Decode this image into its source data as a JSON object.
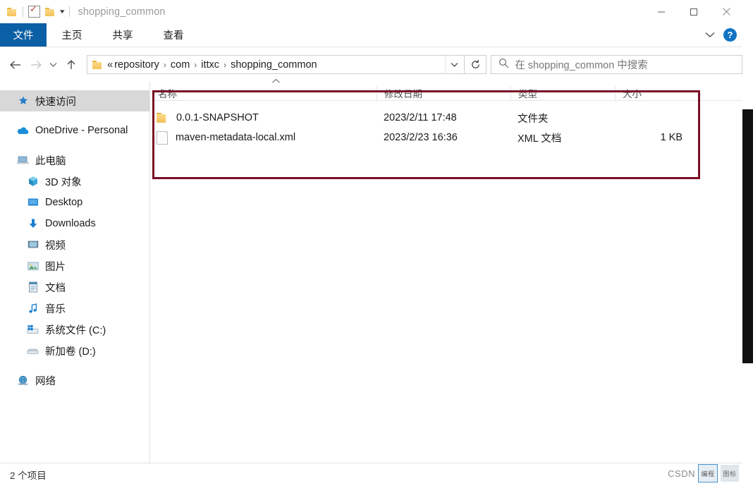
{
  "window": {
    "title": "shopping_common",
    "quick_access": {
      "folder_icon": "folder-icon",
      "properties_icon": "properties-checkmark-icon",
      "new_folder_icon": "new-folder-icon",
      "customize_caret": "chevron-down-icon"
    },
    "controls": {
      "minimize": "minimize-icon",
      "maximize": "maximize-icon",
      "close": "close-icon"
    }
  },
  "ribbon": {
    "tabs": [
      {
        "label": "文件",
        "active": true
      },
      {
        "label": "主页",
        "active": false
      },
      {
        "label": "共享",
        "active": false
      },
      {
        "label": "查看",
        "active": false
      }
    ],
    "collapse_icon": "chevron-down-icon",
    "help_label": "?"
  },
  "navbar": {
    "back_icon": "arrow-left-icon",
    "forward_icon": "arrow-right-icon",
    "history_icon": "chevron-down-icon",
    "up_icon": "arrow-up-icon",
    "address": {
      "folder_icon": "folder-icon",
      "prefix": "«",
      "crumbs": [
        "repository",
        "com",
        "ittxc",
        "shopping_common"
      ],
      "separator": "›",
      "dropdown_icon": "chevron-down-icon"
    },
    "refresh_icon": "refresh-icon",
    "search": {
      "icon": "search-icon",
      "placeholder": "在 shopping_common 中搜索",
      "value": ""
    }
  },
  "sidebar": {
    "items": [
      {
        "label": "快速访问",
        "icon": "pin-star-icon",
        "indent": false,
        "selected": true,
        "gap_before": false
      },
      {
        "label": "OneDrive - Personal",
        "icon": "onedrive-cloud-icon",
        "indent": false,
        "selected": false,
        "gap_before": true
      },
      {
        "label": "此电脑",
        "icon": "this-pc-icon",
        "indent": false,
        "selected": false,
        "gap_before": true
      },
      {
        "label": "3D 对象",
        "icon": "3d-objects-icon",
        "indent": true,
        "selected": false,
        "gap_before": false
      },
      {
        "label": "Desktop",
        "icon": "desktop-icon",
        "indent": true,
        "selected": false,
        "gap_before": false
      },
      {
        "label": "Downloads",
        "icon": "downloads-icon",
        "indent": true,
        "selected": false,
        "gap_before": false
      },
      {
        "label": "视频",
        "icon": "videos-icon",
        "indent": true,
        "selected": false,
        "gap_before": false
      },
      {
        "label": "图片",
        "icon": "pictures-icon",
        "indent": true,
        "selected": false,
        "gap_before": false
      },
      {
        "label": "文档",
        "icon": "documents-icon",
        "indent": true,
        "selected": false,
        "gap_before": false
      },
      {
        "label": "音乐",
        "icon": "music-icon",
        "indent": true,
        "selected": false,
        "gap_before": false
      },
      {
        "label": "系统文件 (C:)",
        "icon": "windows-drive-icon",
        "indent": true,
        "selected": false,
        "gap_before": false
      },
      {
        "label": "新加卷 (D:)",
        "icon": "drive-icon",
        "indent": true,
        "selected": false,
        "gap_before": false
      },
      {
        "label": "网络",
        "icon": "network-icon",
        "indent": false,
        "selected": false,
        "gap_before": true
      }
    ]
  },
  "filelist": {
    "columns": [
      {
        "label": "名称",
        "key": "name"
      },
      {
        "label": "修改日期",
        "key": "date"
      },
      {
        "label": "类型",
        "key": "type"
      },
      {
        "label": "大小",
        "key": "size"
      }
    ],
    "sort": {
      "column": "名称",
      "direction": "ascending",
      "icon": "caret-up-icon"
    },
    "rows": [
      {
        "icon": "folder-icon",
        "name": "0.0.1-SNAPSHOT",
        "date": "2023/2/11 17:48",
        "type": "文件夹",
        "size": ""
      },
      {
        "icon": "xml-document-icon",
        "name": "maven-metadata-local.xml",
        "date": "2023/2/23 16:36",
        "type": "XML 文档",
        "size": "1 KB"
      }
    ]
  },
  "annotation": {
    "color": "#7a0f25",
    "shape": "rectangle"
  },
  "statusbar": {
    "item_count_text": "2 个项目"
  },
  "watermark": {
    "text": "CSDN",
    "badge1": "编程",
    "badge2": "图标"
  }
}
